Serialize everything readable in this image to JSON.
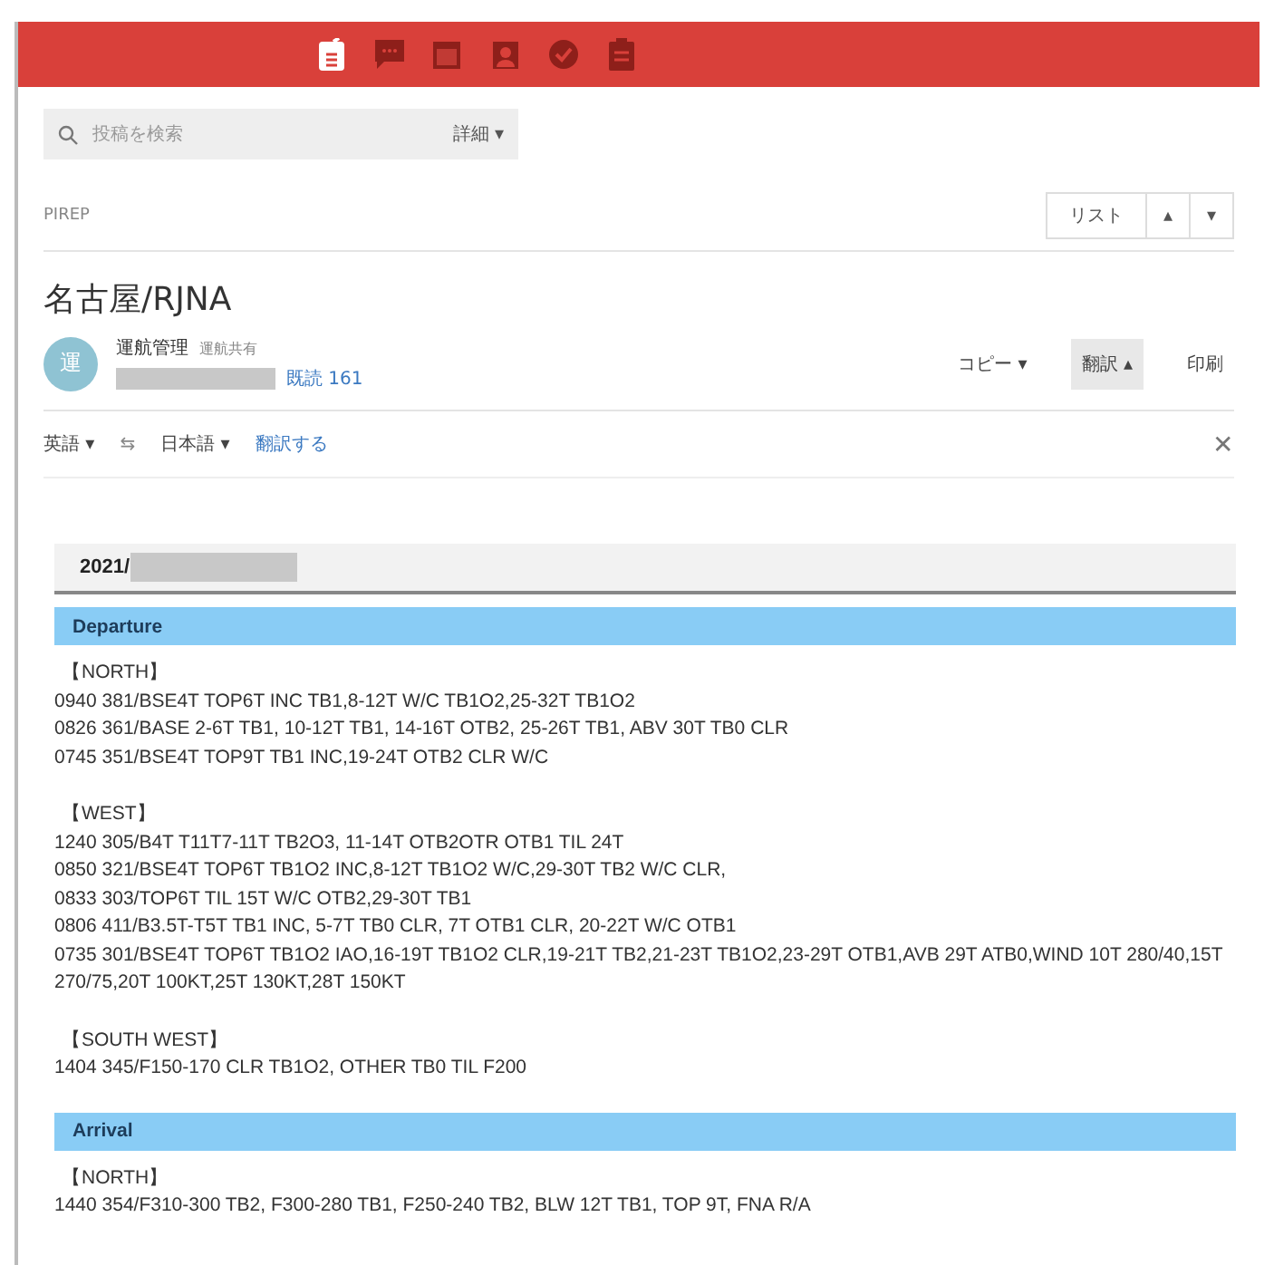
{
  "toolbar": {
    "apps": [
      {
        "kind": "post",
        "selected": true
      },
      {
        "kind": "chat",
        "selected": false
      },
      {
        "kind": "calendar",
        "selected": false
      },
      {
        "kind": "contact",
        "selected": false
      },
      {
        "kind": "check",
        "selected": false
      },
      {
        "kind": "clipboard",
        "selected": false
      }
    ]
  },
  "search": {
    "placeholder": "投稿を検索",
    "detail_button": "詳細 ▾"
  },
  "board": {
    "name": "PIREP",
    "buttons": [
      "リスト",
      "▴",
      "▾"
    ]
  },
  "post": {
    "title": "名古屋/RJNA",
    "avatar": "運",
    "author": "運航管理",
    "author_role": "運航共有",
    "read_count": "既読 161",
    "actions": [
      {
        "label": "コピー ▾",
        "selected": false
      },
      {
        "label": "翻訳 ▴",
        "selected": true
      },
      {
        "label": "印刷",
        "selected": false
      }
    ]
  },
  "translate_bar": {
    "source": "英語 ▾",
    "swap": "⇆",
    "target": "日本語 ▾",
    "action": "翻訳する",
    "close": "✕"
  },
  "report": {
    "date": "2021/",
    "sections": [
      {
        "title": "Departure",
        "groups": [
          {
            "heading": "【NORTH】",
            "lines": [
              "0940 381/BSE4T TOP6T INC TB1,8-12T W/C TB1O2,25-32T TB1O2",
              "0826 361/BASE 2-6T TB1, 10-12T TB1, 14-16T OTB2, 25-26T TB1, ABV 30T TB0 CLR",
              "0745 351/BSE4T TOP9T TB1 INC,19-24T OTB2 CLR W/C"
            ]
          },
          {
            "heading": "【WEST】",
            "lines": [
              "1240 305/B4T T11T7-11T TB2O3, 11-14T OTB2OTR OTB1 TIL 24T",
              "0850 321/BSE4T TOP6T TB1O2 INC,8-12T TB1O2 W/C,29-30T TB2 W/C CLR,",
              "0833 303/TOP6T TIL 15T W/C OTB2,29-30T TB1",
              "0806 411/B3.5T-T5T TB1 INC, 5-7T TB0 CLR, 7T OTB1 CLR, 20-22T W/C OTB1",
              "0735 301/BSE4T TOP6T TB1O2 IAO,16-19T TB1O2 CLR,19-21T TB2,21-23T TB1O2,23-29T OTB1,AVB 29T ATB0,WIND 10T 280/40,15T 270/75,20T 100KT,25T 130KT,28T 150KT"
            ]
          },
          {
            "heading": "【SOUTH WEST】",
            "lines": [
              "1404 345/F150-170 CLR TB1O2, OTHER TB0 TIL F200"
            ]
          }
        ]
      },
      {
        "title": "Arrival",
        "groups": [
          {
            "heading": "【NORTH】",
            "lines": [
              "1440 354/F310-300 TB2, F300-280 TB1, F250-240 TB2, BLW 12T TB1, TOP 9T, FNA R/A"
            ]
          }
        ]
      }
    ]
  }
}
